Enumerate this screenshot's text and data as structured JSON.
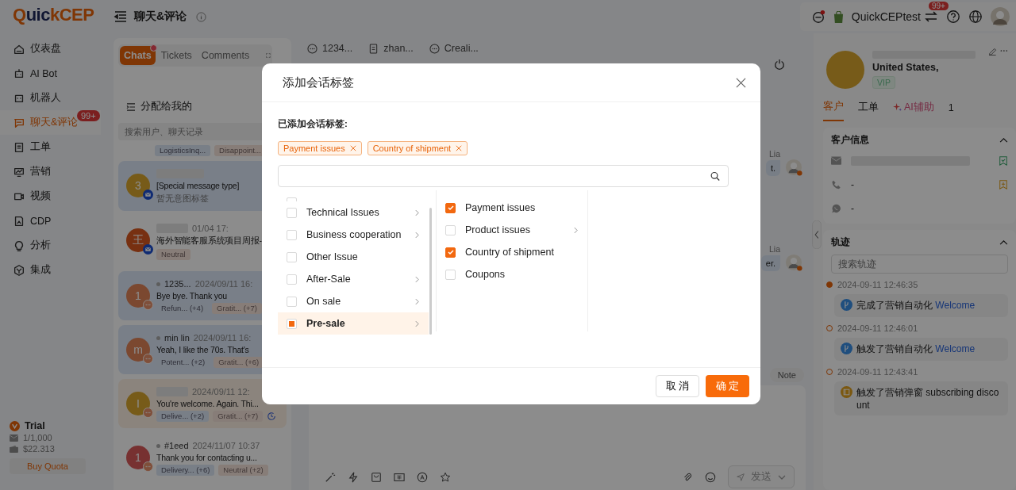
{
  "sidebar": {
    "logo": "QuickCEP",
    "items": [
      {
        "label": "仪表盘",
        "selected": false
      },
      {
        "label": "AI Bot",
        "selected": false
      },
      {
        "label": "机器人",
        "selected": false
      },
      {
        "label": "聊天&评论",
        "selected": true,
        "badge": "99+"
      },
      {
        "label": "工单",
        "selected": false
      },
      {
        "label": "营销",
        "selected": false
      },
      {
        "label": "视频",
        "selected": false
      },
      {
        "label": "CDP",
        "selected": false
      },
      {
        "label": "分析",
        "selected": false
      },
      {
        "label": "集成",
        "selected": false
      }
    ],
    "plan": {
      "name": "Trial",
      "quota": "1/1,000",
      "balance": "$22.313",
      "button": "Buy Quota"
    }
  },
  "topbar": {
    "title": "聊天&评论",
    "account": "QuickCEPtest",
    "badge": "99+"
  },
  "chat_list": {
    "tabs": [
      {
        "label": "Chats",
        "selected": true,
        "dot": true
      },
      {
        "label": "Tickets",
        "selected": false,
        "dot": false
      },
      {
        "label": "Comments",
        "selected": false,
        "dot": false
      }
    ],
    "filter": "分配给我的",
    "search": {
      "placeholder": "搜索用户、聊天记录"
    },
    "partial_tags": [
      {
        "text": "LogisticsInq...",
        "kind": "intent"
      },
      {
        "text": "Disappoint...",
        "kind": "sentiment"
      }
    ],
    "items": [
      {
        "avatar": "3",
        "kind": "email",
        "message": "[Special message type]",
        "note": "暂无意图标签",
        "unread": true,
        "selected": false
      },
      {
        "avatar": "王",
        "kind": "email",
        "time": "01/04 17:",
        "message": "海外智能客服系统项目周报-",
        "tags": [
          {
            "text": "Neutral",
            "kind": "sentiment"
          }
        ],
        "unread": false,
        "selected": false
      },
      {
        "avatar": "1",
        "kind": "chat",
        "name": "1235...",
        "time": "2024/09/11 16:",
        "message": "Bye bye. Thank you",
        "tags": [
          {
            "text": "Refun... (+4)",
            "kind": "intent"
          },
          {
            "text": "Gratit... (+7)",
            "kind": "sentiment"
          }
        ],
        "unread": true,
        "selected": false
      },
      {
        "avatar": "m",
        "kind": "chat",
        "name": "min lin",
        "time": "2024/09/11 16:",
        "message": "Yeah, I like the 70s. That's",
        "tags": [
          {
            "text": "Potent... (+2)",
            "kind": "intent"
          },
          {
            "text": "Gratit... (+6)",
            "kind": "sentiment"
          }
        ],
        "unread": true,
        "selected": false
      },
      {
        "avatar": "I",
        "kind": "chat",
        "time": "2024/09/11 12:",
        "message": "You're welcome. Again. Thi...",
        "tags": [
          {
            "text": "Delive... (+2)",
            "kind": "intent"
          },
          {
            "text": "Gratit... (+7)",
            "kind": "sentiment"
          }
        ],
        "unread": false,
        "selected": true,
        "pending": true
      },
      {
        "avatar": "1",
        "kind": "chat",
        "name": "#1eed",
        "time": "2024/11/07 10:37",
        "message": "Thank you for contacting u...",
        "tags": [
          {
            "text": "Delivery... (+6)",
            "kind": "intent"
          },
          {
            "text": "Neutral (+2)",
            "kind": "sentiment"
          }
        ],
        "unread": false,
        "selected": false
      }
    ]
  },
  "conversation": {
    "tabs": [
      {
        "label": "1234...",
        "kind": "chat"
      },
      {
        "label": "zhan...",
        "kind": "ticket"
      },
      {
        "label": "Creali...",
        "kind": "chat"
      }
    ],
    "messages": [
      {
        "sender": "Lia",
        "fragment": "t."
      },
      {
        "sender": "Lia",
        "fragment": "er."
      }
    ],
    "note_button": "Note",
    "send_button": "发送"
  },
  "customer": {
    "location": "United States,",
    "tag": "VIP",
    "tabs": [
      {
        "label": "客户",
        "selected": true,
        "kind": "plain"
      },
      {
        "label": "工单",
        "selected": false,
        "kind": "plain"
      },
      {
        "label": "AI辅助",
        "selected": false,
        "kind": "ai"
      },
      {
        "label": "1",
        "selected": false,
        "kind": "plain"
      }
    ],
    "info_title": "客户信息",
    "phone": "-",
    "whatsapp": "-",
    "track_title": "轨迹",
    "track_search": {
      "placeholder": "搜索轨迹"
    },
    "timeline": [
      {
        "time": "2024-09-11 12:46:35",
        "text": "完成了营销自动化",
        "link": "Welcome",
        "kind": "automation",
        "latest": true
      },
      {
        "time": "2024-09-11 12:46:01",
        "text": "触发了营销自动化",
        "link": "Welcome",
        "kind": "automation",
        "latest": false
      },
      {
        "time": "2024-09-11 12:43:41",
        "text": "触发了营销弹窗 subscribing discount",
        "kind": "popup",
        "latest": false
      }
    ]
  },
  "dialog": {
    "title": "添加会话标签",
    "added_label": "已添加会话标签:",
    "chips": [
      "Payment issues",
      "Country of shipment"
    ],
    "categories": [
      {
        "label": "Technical Issues",
        "checked": false,
        "partial": false,
        "has_children": true,
        "selected": false
      },
      {
        "label": "Business cooperation",
        "checked": false,
        "partial": false,
        "has_children": true,
        "selected": false
      },
      {
        "label": "Other Issue",
        "checked": false,
        "partial": false,
        "has_children": false,
        "selected": false
      },
      {
        "label": "After-Sale",
        "checked": false,
        "partial": false,
        "has_children": true,
        "selected": false
      },
      {
        "label": "On sale",
        "checked": false,
        "partial": false,
        "has_children": true,
        "selected": false
      },
      {
        "label": "Pre-sale",
        "checked": false,
        "partial": true,
        "has_children": true,
        "selected": true
      }
    ],
    "subcategories": [
      {
        "label": "Payment issues",
        "checked": true,
        "has_children": false
      },
      {
        "label": "Product issues",
        "checked": false,
        "has_children": true
      },
      {
        "label": "Country of shipment",
        "checked": true,
        "has_children": false
      },
      {
        "label": "Coupons",
        "checked": false,
        "has_children": false
      }
    ],
    "cancel": "取 消",
    "confirm": "确 定"
  }
}
